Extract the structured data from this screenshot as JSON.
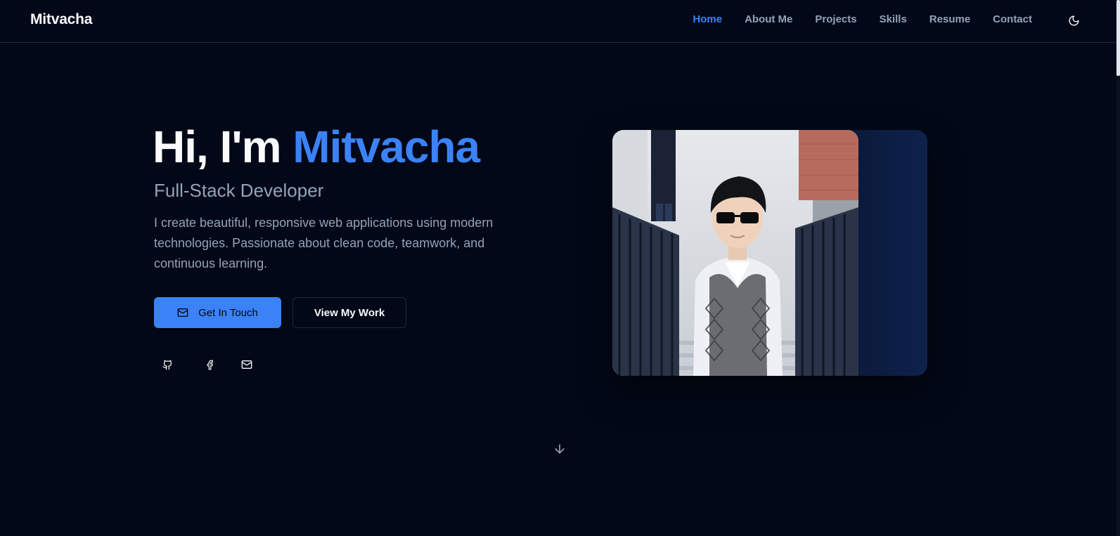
{
  "brand": "Mitvacha",
  "nav": {
    "links": [
      {
        "label": "Home",
        "active": true
      },
      {
        "label": "About Me",
        "active": false
      },
      {
        "label": "Projects",
        "active": false
      },
      {
        "label": "Skills",
        "active": false
      },
      {
        "label": "Resume",
        "active": false
      },
      {
        "label": "Contact",
        "active": false
      }
    ],
    "theme_toggle_icon": "moon-icon"
  },
  "hero": {
    "greeting": "Hi, I'm ",
    "name": "Mitvacha",
    "subtitle": "Full-Stack Developer",
    "description": "I create beautiful, responsive web applications using modern technologies. Passionate about clean code, teamwork, and continuous learning.",
    "primary_button": {
      "label": "Get In Touch",
      "icon": "mail-icon"
    },
    "secondary_button": {
      "label": "View My Work"
    },
    "socials": [
      "github-icon",
      "facebook-icon",
      "mail-icon"
    ],
    "scroll_icon": "arrow-down-icon"
  },
  "colors": {
    "background": "#020817",
    "accent": "#3b82f6",
    "text": "#f8fafc",
    "muted": "#94a3b8",
    "border": "#1e293b"
  }
}
